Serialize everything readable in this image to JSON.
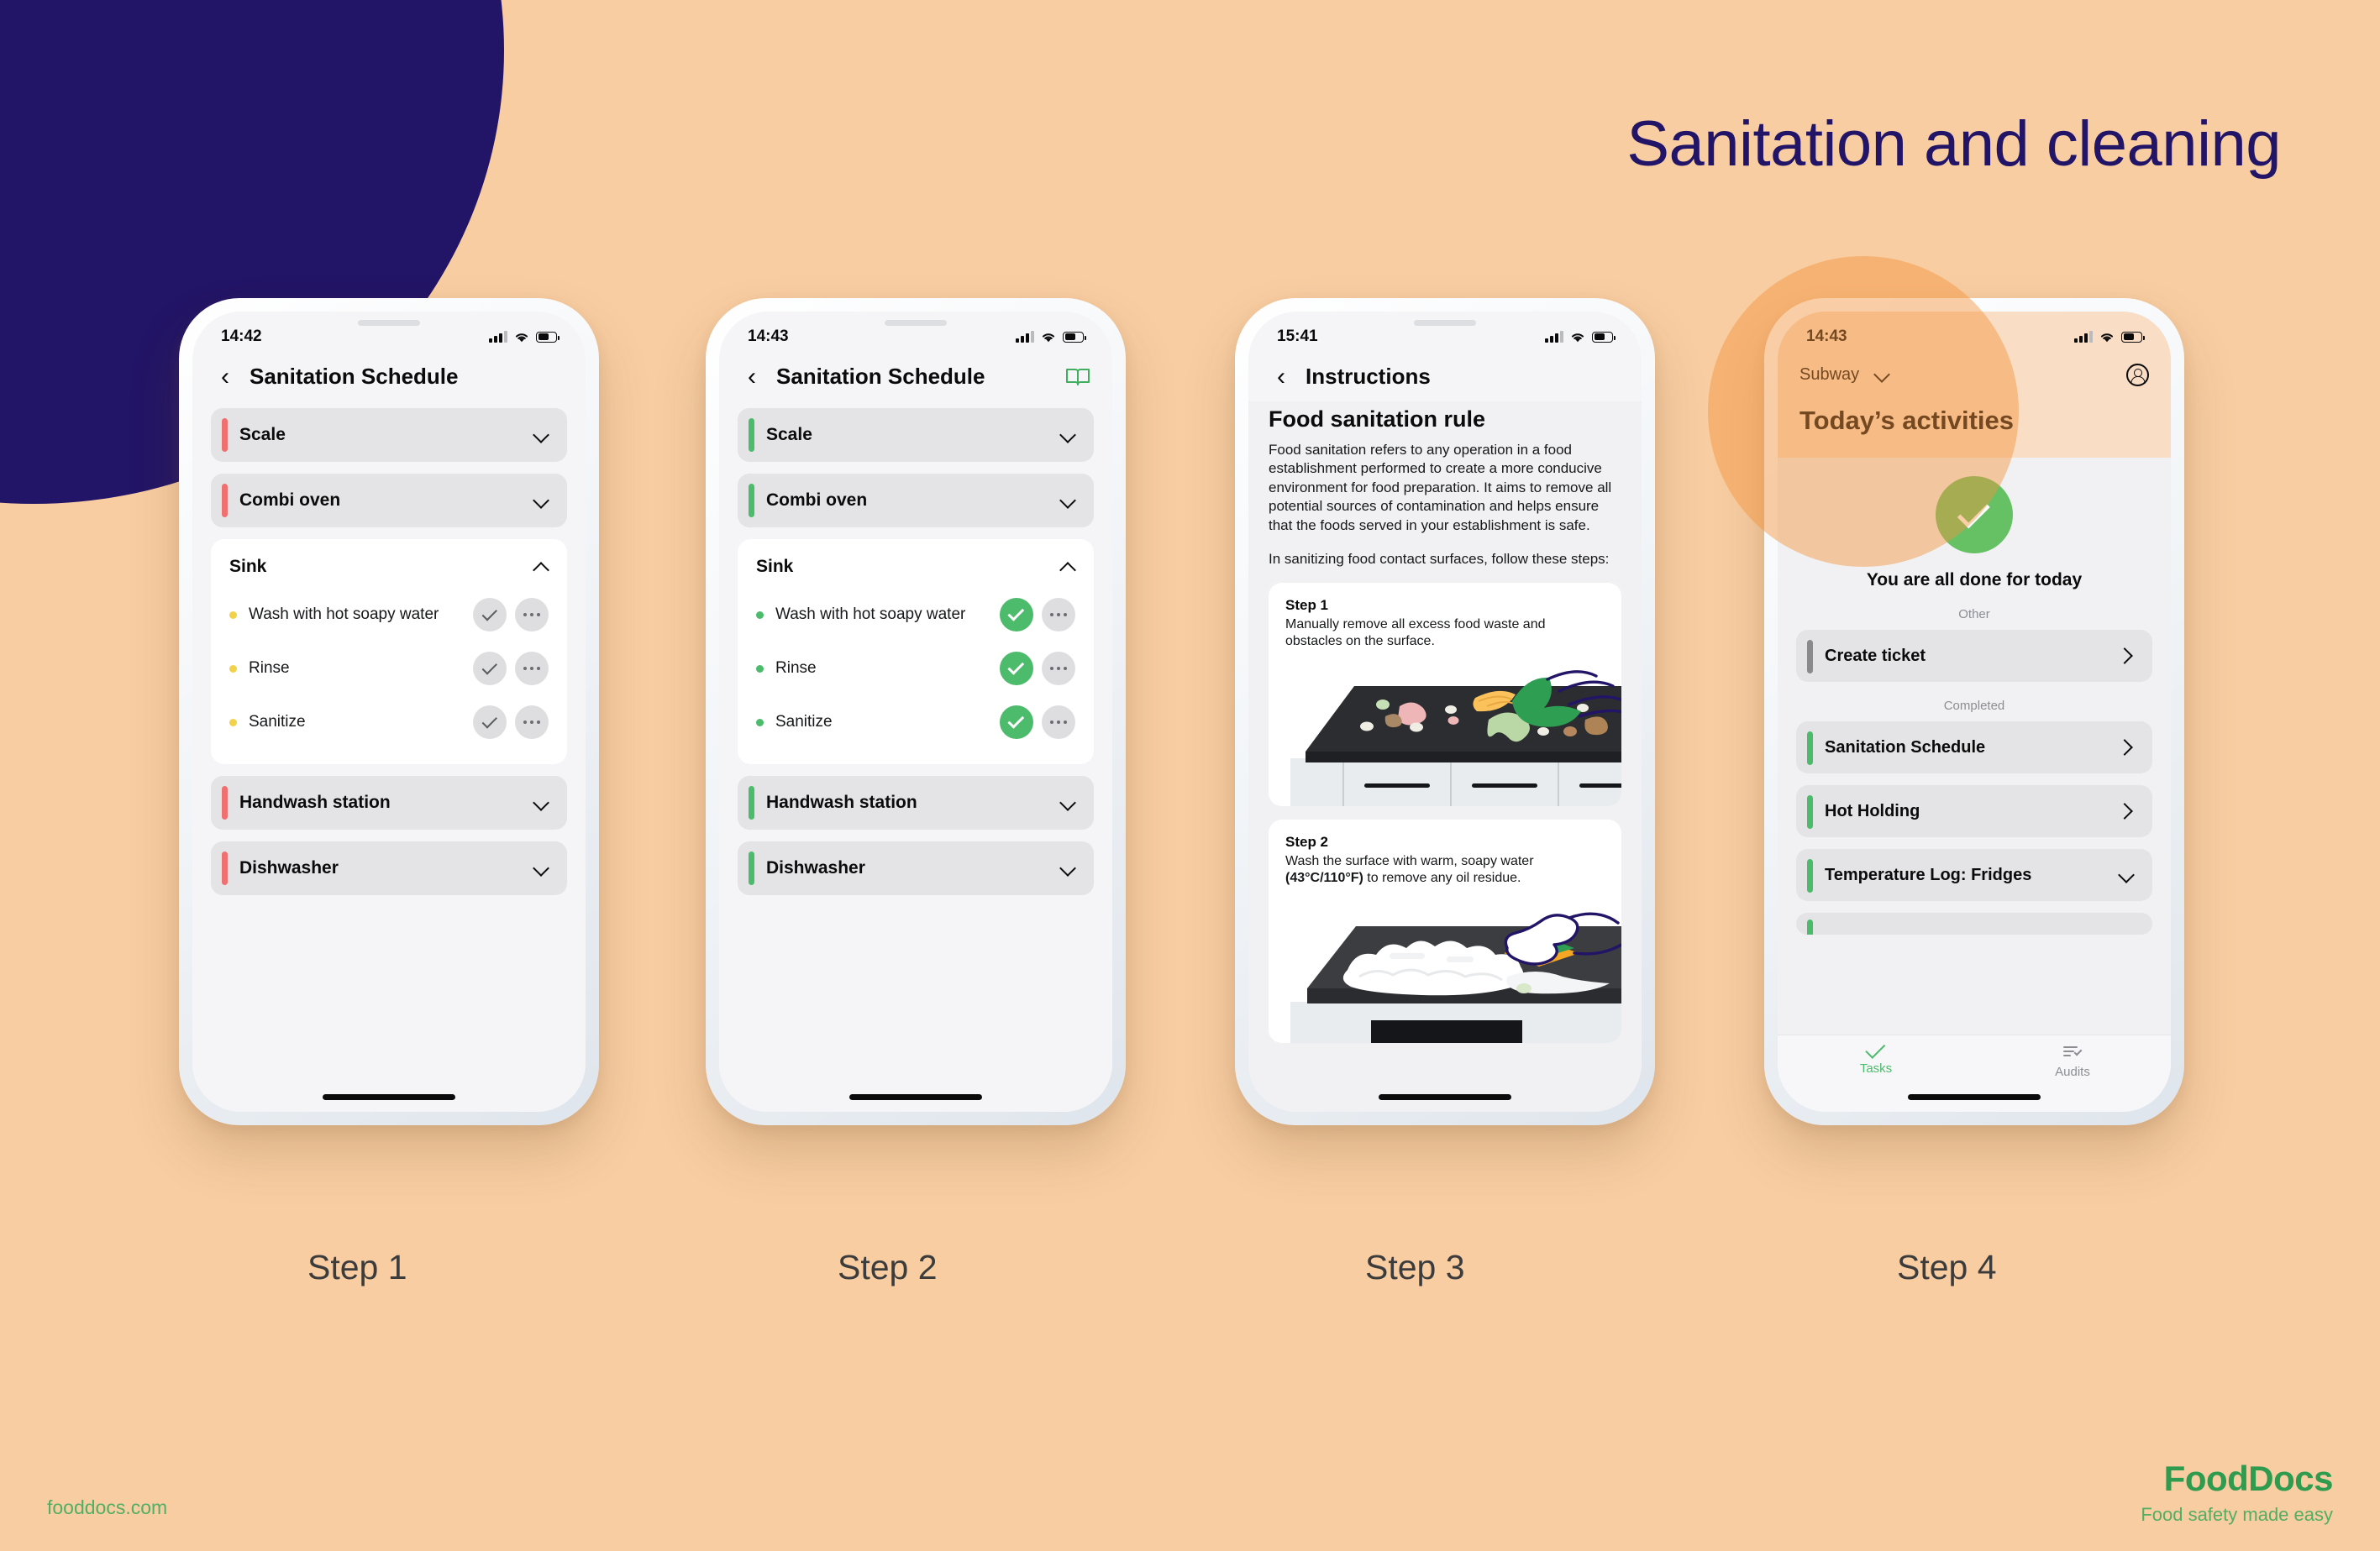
{
  "headline": "Sanitation and cleaning",
  "colors": {
    "background": "#F8CDA2",
    "navy": "#221466",
    "green": "#4CBB6B",
    "salmon": "#EF7070",
    "grey_bar": "#8A8A8E",
    "brand_green": "#2E9B4E"
  },
  "captions": {
    "step1": "Step 1",
    "step2": "Step 2",
    "step3": "Step 3",
    "step4": "Step 4"
  },
  "phone1": {
    "status": {
      "time": "14:42"
    },
    "nav": {
      "back": "‹",
      "title": "Sanitation Schedule"
    },
    "rows": [
      {
        "label": "Scale",
        "chevron": "down"
      },
      {
        "label": "Combi oven",
        "chevron": "down"
      }
    ],
    "expanded": {
      "label": "Sink",
      "chevron": "up",
      "tasks": [
        {
          "label": "Wash with hot soapy water",
          "state": "pending"
        },
        {
          "label": "Rinse",
          "state": "pending"
        },
        {
          "label": "Sanitize",
          "state": "pending"
        }
      ]
    },
    "rows_after": [
      {
        "label": "Handwash station",
        "chevron": "down"
      },
      {
        "label": "Dishwasher",
        "chevron": "down"
      }
    ]
  },
  "phone2": {
    "status": {
      "time": "14:43"
    },
    "nav": {
      "back": "‹",
      "title": "Sanitation Schedule",
      "action_icon": "book-icon"
    },
    "rows": [
      {
        "label": "Scale",
        "chevron": "down"
      },
      {
        "label": "Combi oven",
        "chevron": "down"
      }
    ],
    "expanded": {
      "label": "Sink",
      "chevron": "up",
      "tasks": [
        {
          "label": "Wash with hot soapy water",
          "state": "done"
        },
        {
          "label": "Rinse",
          "state": "done"
        },
        {
          "label": "Sanitize",
          "state": "done"
        }
      ]
    },
    "rows_after": [
      {
        "label": "Handwash station",
        "chevron": "down"
      },
      {
        "label": "Dishwasher",
        "chevron": "down"
      }
    ]
  },
  "phone3": {
    "status": {
      "time": "15:41"
    },
    "nav": {
      "back": "‹",
      "title": "Instructions"
    },
    "heading": "Food sanitation rule",
    "paragraph": "Food sanitation refers to any operation in a food establishment performed to create a more conducive environment for food preparation. It aims to remove all potential sources of contamination and helps ensure that the foods served in your establishment is safe.",
    "paragraph2": "In sanitizing food contact surfaces, follow these steps:",
    "steps": [
      {
        "title": "Step 1",
        "text": "Manually remove all excess food waste and obstacles on the surface."
      },
      {
        "title": "Step 2",
        "text_before": "Wash the surface with warm, soapy water ",
        "text_bold": "(43°C/110°F)",
        "text_after": " to remove any oil residue."
      }
    ]
  },
  "phone4": {
    "status": {
      "time": "14:43"
    },
    "org": "Subway",
    "title": "Today’s activities",
    "done_text": "You are all done for today",
    "sections": [
      {
        "label": "Other",
        "items": [
          {
            "label": "Create ticket",
            "bar": "grey",
            "chevron": "right"
          }
        ]
      },
      {
        "label": "Completed",
        "items": [
          {
            "label": "Sanitation Schedule",
            "bar": "green",
            "chevron": "right"
          },
          {
            "label": "Hot Holding",
            "bar": "green",
            "chevron": "right"
          },
          {
            "label": "Temperature Log: Fridges",
            "bar": "green",
            "chevron": "down"
          }
        ]
      }
    ],
    "tabs": [
      {
        "label": "Tasks",
        "icon": "check-icon",
        "active": true
      },
      {
        "label": "Audits",
        "icon": "audits-icon",
        "active": false
      }
    ]
  },
  "footer": {
    "url": "fooddocs.com",
    "logo": "FoodDocs",
    "tagline": "Food safety made easy"
  }
}
